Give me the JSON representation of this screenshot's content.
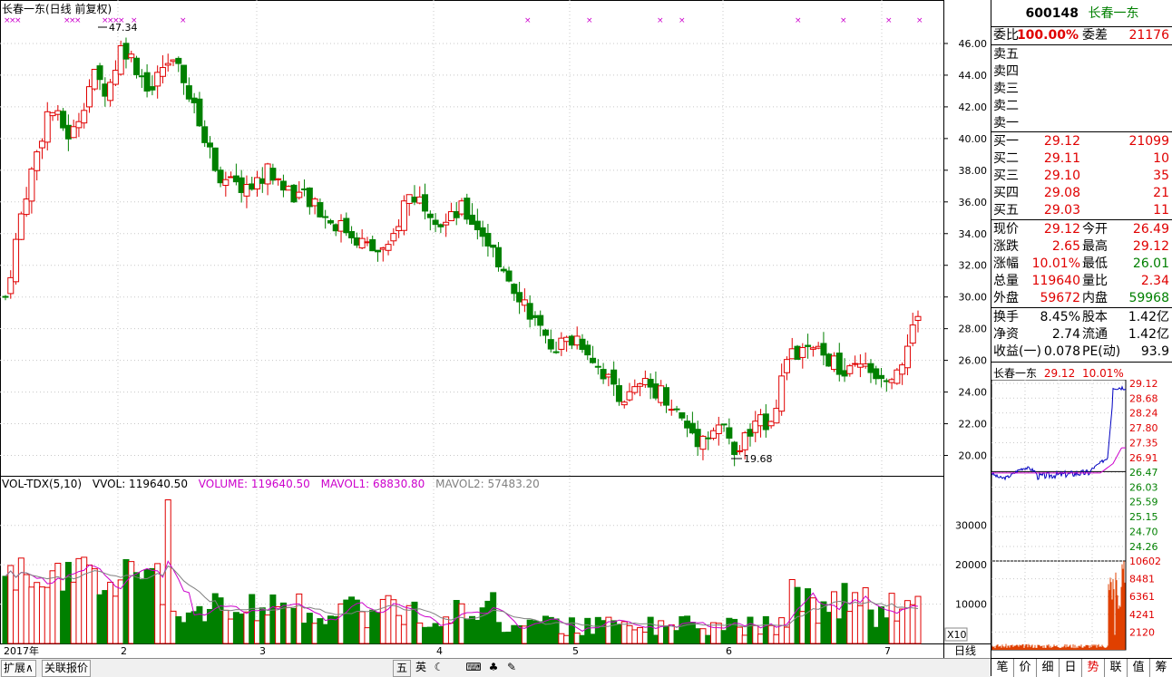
{
  "stock": {
    "title": "长春一东(日线 前复权)",
    "code": "600148",
    "name": "长春一东"
  },
  "price_axis": [
    "46.00",
    "44.00",
    "42.00",
    "40.00",
    "38.00",
    "36.00",
    "34.00",
    "32.00",
    "30.00",
    "28.00",
    "26.00",
    "24.00",
    "22.00",
    "20.00"
  ],
  "annotations": {
    "high": "47.34",
    "low": "19.68"
  },
  "volume": {
    "indicator": "VOL-TDX(5,10)",
    "vvol": "VVOL: 119640.50",
    "volume": "VOLUME: 119640.50",
    "mavol1": "MAVOL1: 68830.80",
    "mavol2": "MAVOL2: 57483.20",
    "axis": [
      "30000",
      "20000",
      "10000"
    ],
    "zoom": "X10"
  },
  "time_axis": {
    "start": "2017年",
    "months": [
      "2",
      "3",
      "4",
      "5",
      "6",
      "7"
    ],
    "period": "日线"
  },
  "colors": {
    "up": "#e00000",
    "down": "#008000",
    "ma1": "#cc00cc",
    "ma2": "#808080",
    "grid": "#b0b0b0"
  },
  "quote": {
    "wb_label": "委比",
    "wb": "100.00%",
    "wc_label": "委差",
    "wc": "21176",
    "sell": [
      {
        "l": "卖五"
      },
      {
        "l": "卖四"
      },
      {
        "l": "卖三"
      },
      {
        "l": "卖二"
      },
      {
        "l": "卖一"
      }
    ],
    "buy": [
      {
        "l": "买一",
        "p": "29.12",
        "v": "21099"
      },
      {
        "l": "买二",
        "p": "29.11",
        "v": "10"
      },
      {
        "l": "买三",
        "p": "29.10",
        "v": "35"
      },
      {
        "l": "买四",
        "p": "29.08",
        "v": "21"
      },
      {
        "l": "买五",
        "p": "29.03",
        "v": "11"
      }
    ],
    "stats": [
      {
        "a": "现价",
        "av": "29.12",
        "b": "今开",
        "bv": "26.49",
        "ac": "red",
        "bc": "red"
      },
      {
        "a": "涨跌",
        "av": "2.65",
        "b": "最高",
        "bv": "29.12",
        "ac": "red",
        "bc": "red"
      },
      {
        "a": "涨幅",
        "av": "10.01%",
        "b": "最低",
        "bv": "26.01",
        "ac": "red",
        "bc": "green"
      },
      {
        "a": "总量",
        "av": "119640",
        "b": "量比",
        "bv": "2.34",
        "ac": "red",
        "bc": "red"
      },
      {
        "a": "外盘",
        "av": "59672",
        "b": "内盘",
        "bv": "59968",
        "ac": "red",
        "bc": "green"
      }
    ],
    "fund": [
      {
        "a": "换手",
        "av": "8.45%",
        "b": "股本",
        "bv": "1.42亿"
      },
      {
        "a": "净资",
        "av": "2.74",
        "b": "流通",
        "bv": "1.42亿"
      },
      {
        "a": "收益(一)",
        "av": "0.078",
        "b": "PE(动)",
        "bv": "93.9"
      }
    ]
  },
  "mini": {
    "title_name": "长春一东",
    "title_price": "29.12",
    "title_pct": "10.01%",
    "price_axis": [
      "29.12",
      "28.68",
      "28.24",
      "27.80",
      "27.35",
      "26.91",
      "26.47",
      "26.03",
      "25.59",
      "25.15",
      "24.70",
      "24.26"
    ],
    "vol_axis": [
      "10602",
      "8481",
      "6361",
      "4241",
      "2120"
    ]
  },
  "tabs": [
    "笔",
    "价",
    "细",
    "日",
    "势",
    "联",
    "值",
    "筹"
  ],
  "bottom": {
    "expand": "扩展∧",
    "related": "关联报价",
    "tools": [
      "五",
      "英",
      "☾",
      "⌨",
      "♣",
      "✎"
    ]
  }
}
